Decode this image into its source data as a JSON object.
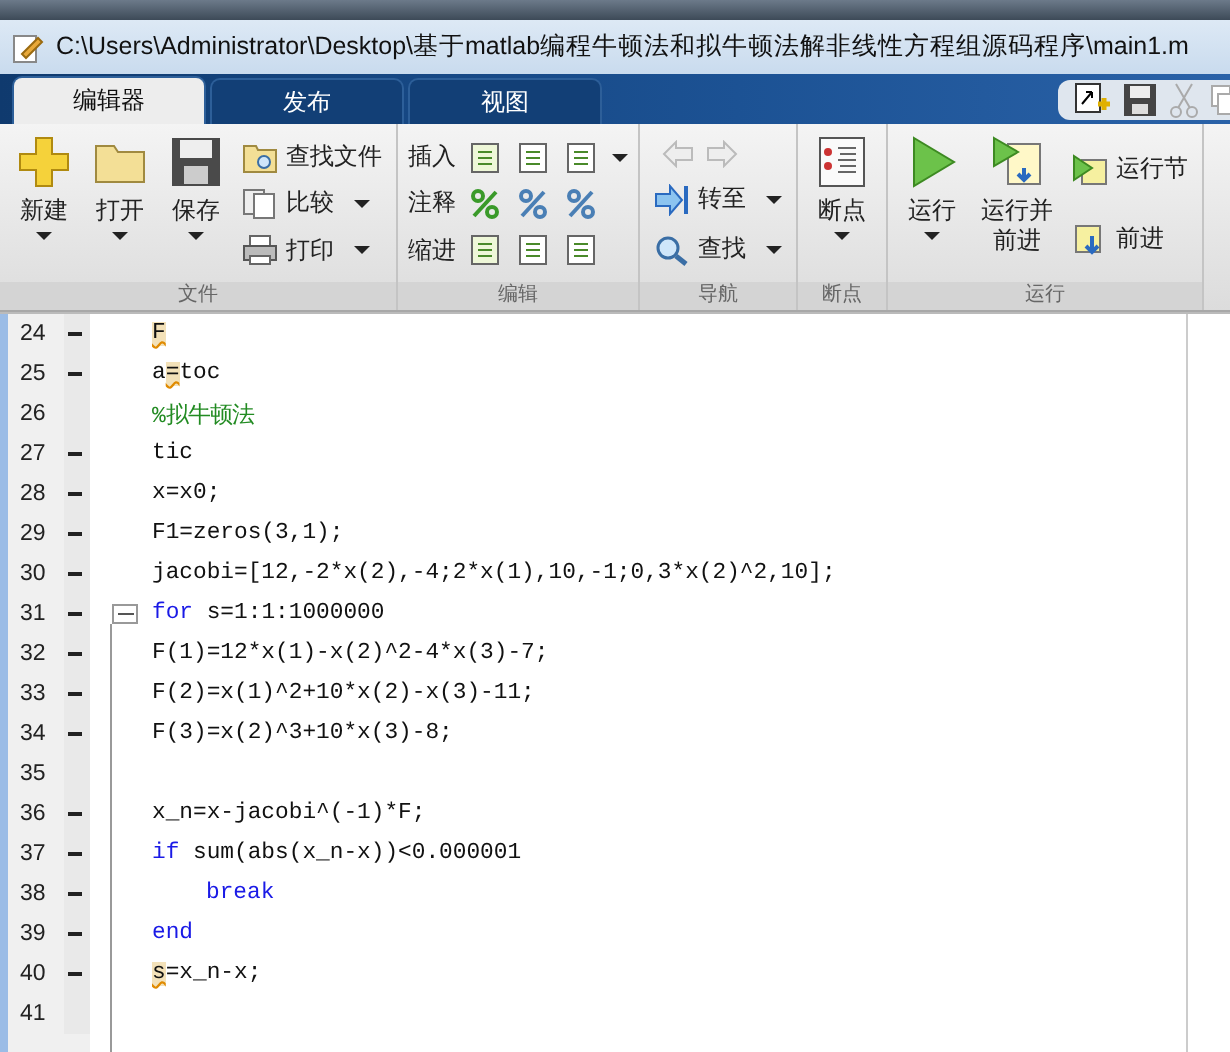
{
  "title_bar": {
    "path": "C:\\Users\\Administrator\\Desktop\\基于matlab编程牛顿法和拟牛顿法解非线性方程组源码程序\\main1.m"
  },
  "tabs": [
    {
      "label": "编辑器",
      "selected": true
    },
    {
      "label": "发布",
      "selected": false
    },
    {
      "label": "视图",
      "selected": false
    }
  ],
  "ribbon_groups": [
    {
      "label": "文件",
      "items": [
        {
          "kind": "large",
          "label": "新建",
          "caret": true
        },
        {
          "kind": "large",
          "label": "打开",
          "caret": true
        },
        {
          "kind": "large",
          "label": "保存",
          "caret": true
        },
        {
          "kind": "stack",
          "rows": [
            {
              "kind": "text",
              "label": "查找文件",
              "caret": false
            },
            {
              "kind": "text",
              "label": "比较",
              "caret": true
            },
            {
              "kind": "text",
              "label": "打印",
              "caret": true
            }
          ]
        }
      ]
    },
    {
      "label": "编辑",
      "items": [
        {
          "kind": "iconrows",
          "rows": [
            {
              "label": "插入",
              "caret": true
            },
            {
              "label": "注释",
              "caret": false
            },
            {
              "label": "缩进",
              "caret": false
            }
          ]
        }
      ]
    },
    {
      "label": "导航",
      "items": [
        {
          "kind": "stack",
          "rows": [
            {
              "kind": "arrows",
              "disabled": true
            },
            {
              "kind": "text",
              "label": "转至",
              "caret": true
            },
            {
              "kind": "text",
              "label": "查找",
              "caret": true
            }
          ]
        }
      ]
    },
    {
      "label": "断点",
      "items": [
        {
          "kind": "large",
          "label": "断点",
          "caret": true
        }
      ]
    },
    {
      "label": "运行",
      "items": [
        {
          "kind": "large",
          "label": "运行",
          "caret": true
        },
        {
          "kind": "large",
          "label": "运行并前进",
          "caret": false
        },
        {
          "kind": "stack",
          "rows": [
            {
              "kind": "text",
              "label": "运行节",
              "caret": false
            },
            {
              "kind": "text",
              "label": "前进",
              "caret": false
            }
          ]
        }
      ]
    }
  ],
  "editor": {
    "lines": [
      {
        "num": "24",
        "dash": true,
        "fold": false,
        "tokens": [
          {
            "kind": "warn",
            "text": "F"
          }
        ]
      },
      {
        "num": "25",
        "dash": true,
        "fold": false,
        "tokens": [
          {
            "kind": "plain",
            "text": "a"
          },
          {
            "kind": "warn",
            "text": "="
          },
          {
            "kind": "plain",
            "text": "toc"
          }
        ]
      },
      {
        "num": "26",
        "dash": false,
        "fold": false,
        "tokens": [
          {
            "kind": "comment",
            "text": "%拟牛顿法"
          }
        ]
      },
      {
        "num": "27",
        "dash": true,
        "fold": false,
        "tokens": [
          {
            "kind": "plain",
            "text": "tic"
          }
        ]
      },
      {
        "num": "28",
        "dash": true,
        "fold": false,
        "tokens": [
          {
            "kind": "plain",
            "text": "x=x0;"
          }
        ]
      },
      {
        "num": "29",
        "dash": true,
        "fold": false,
        "tokens": [
          {
            "kind": "plain",
            "text": "F1=zeros(3,1);"
          }
        ]
      },
      {
        "num": "30",
        "dash": true,
        "fold": false,
        "tokens": [
          {
            "kind": "plain",
            "text": "jacobi=[12,-2*x(2),-4;2*x(1),10,-1;0,3*x(2)^2,10];"
          }
        ]
      },
      {
        "num": "31",
        "dash": true,
        "fold": true,
        "tokens": [
          {
            "kind": "keyword",
            "text": "for"
          },
          {
            "kind": "plain",
            "text": " s=1:1:1000000"
          }
        ]
      },
      {
        "num": "32",
        "dash": true,
        "fold": false,
        "tokens": [
          {
            "kind": "plain",
            "text": "F(1)=12*x(1)-x(2)^2-4*x(3)-7;"
          }
        ]
      },
      {
        "num": "33",
        "dash": true,
        "fold": false,
        "tokens": [
          {
            "kind": "plain",
            "text": "F(2)=x(1)^2+10*x(2)-x(3)-11;"
          }
        ]
      },
      {
        "num": "34",
        "dash": true,
        "fold": false,
        "tokens": [
          {
            "kind": "plain",
            "text": "F(3)=x(2)^3+10*x(3)-8;"
          }
        ]
      },
      {
        "num": "35",
        "dash": false,
        "fold": false
      },
      {
        "num": "36",
        "dash": true,
        "fold": false,
        "tokens": [
          {
            "kind": "plain",
            "text": "x_n=x-jacobi^(-1)*F;"
          }
        ]
      },
      {
        "num": "37",
        "dash": true,
        "fold": false,
        "tokens": [
          {
            "kind": "keyword",
            "text": "if"
          },
          {
            "kind": "plain",
            "text": " sum(abs(x_n-x))<0.000001"
          }
        ]
      },
      {
        "num": "38",
        "dash": true,
        "fold": false,
        "indented": true,
        "tokens": [
          {
            "kind": "keyword",
            "text": "break"
          }
        ]
      },
      {
        "num": "39",
        "dash": true,
        "fold": false,
        "tokens": [
          {
            "kind": "keyword",
            "text": "end"
          }
        ]
      },
      {
        "num": "40",
        "dash": true,
        "fold": false,
        "tokens": [
          {
            "kind": "warn",
            "text": "s"
          },
          {
            "kind": "plain",
            "text": "=x_n-x;"
          }
        ]
      },
      {
        "num": "41",
        "dash": false,
        "fold": false
      }
    ]
  }
}
